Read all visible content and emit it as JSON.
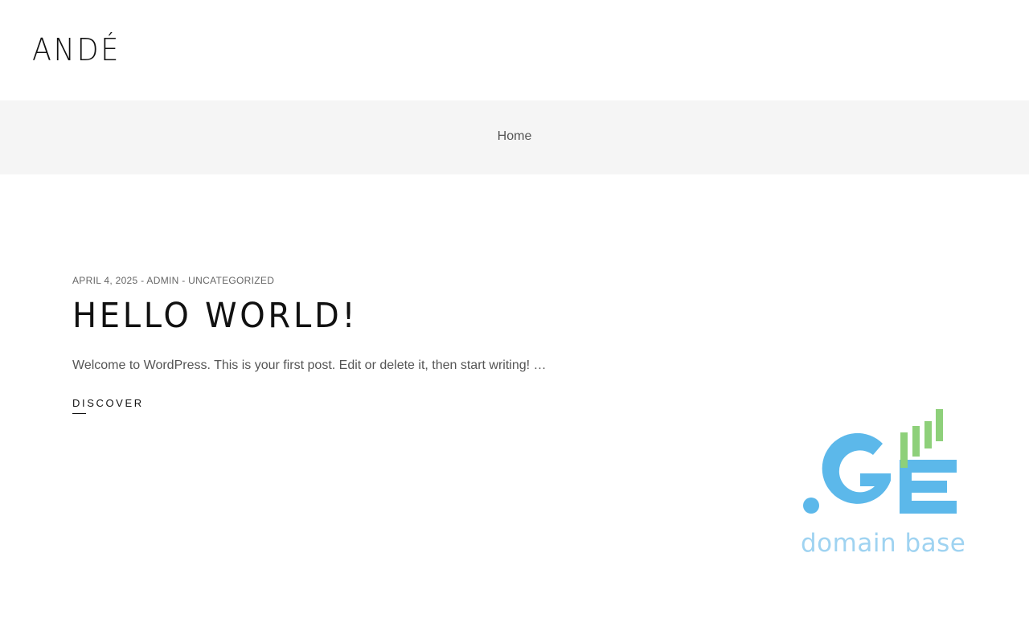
{
  "header": {
    "logo_text": "ANDÉ"
  },
  "breadcrumb": {
    "home_label": "Home"
  },
  "post": {
    "date": "APRIL 4, 2025",
    "separator": " - ",
    "author": "ADMIN",
    "category": "UNCATEGORIZED",
    "title": "HELLO WORLD!",
    "excerpt": "Welcome to WordPress. This is your first post. Edit or delete it, then start writing! …",
    "cta_label": "DISCOVER"
  },
  "badge": {
    "logo_text": ".GE",
    "caption": "domain base",
    "colors": {
      "blue": "#5cb8ea",
      "green": "#8ed07a",
      "caption": "#9fd3f1"
    }
  }
}
